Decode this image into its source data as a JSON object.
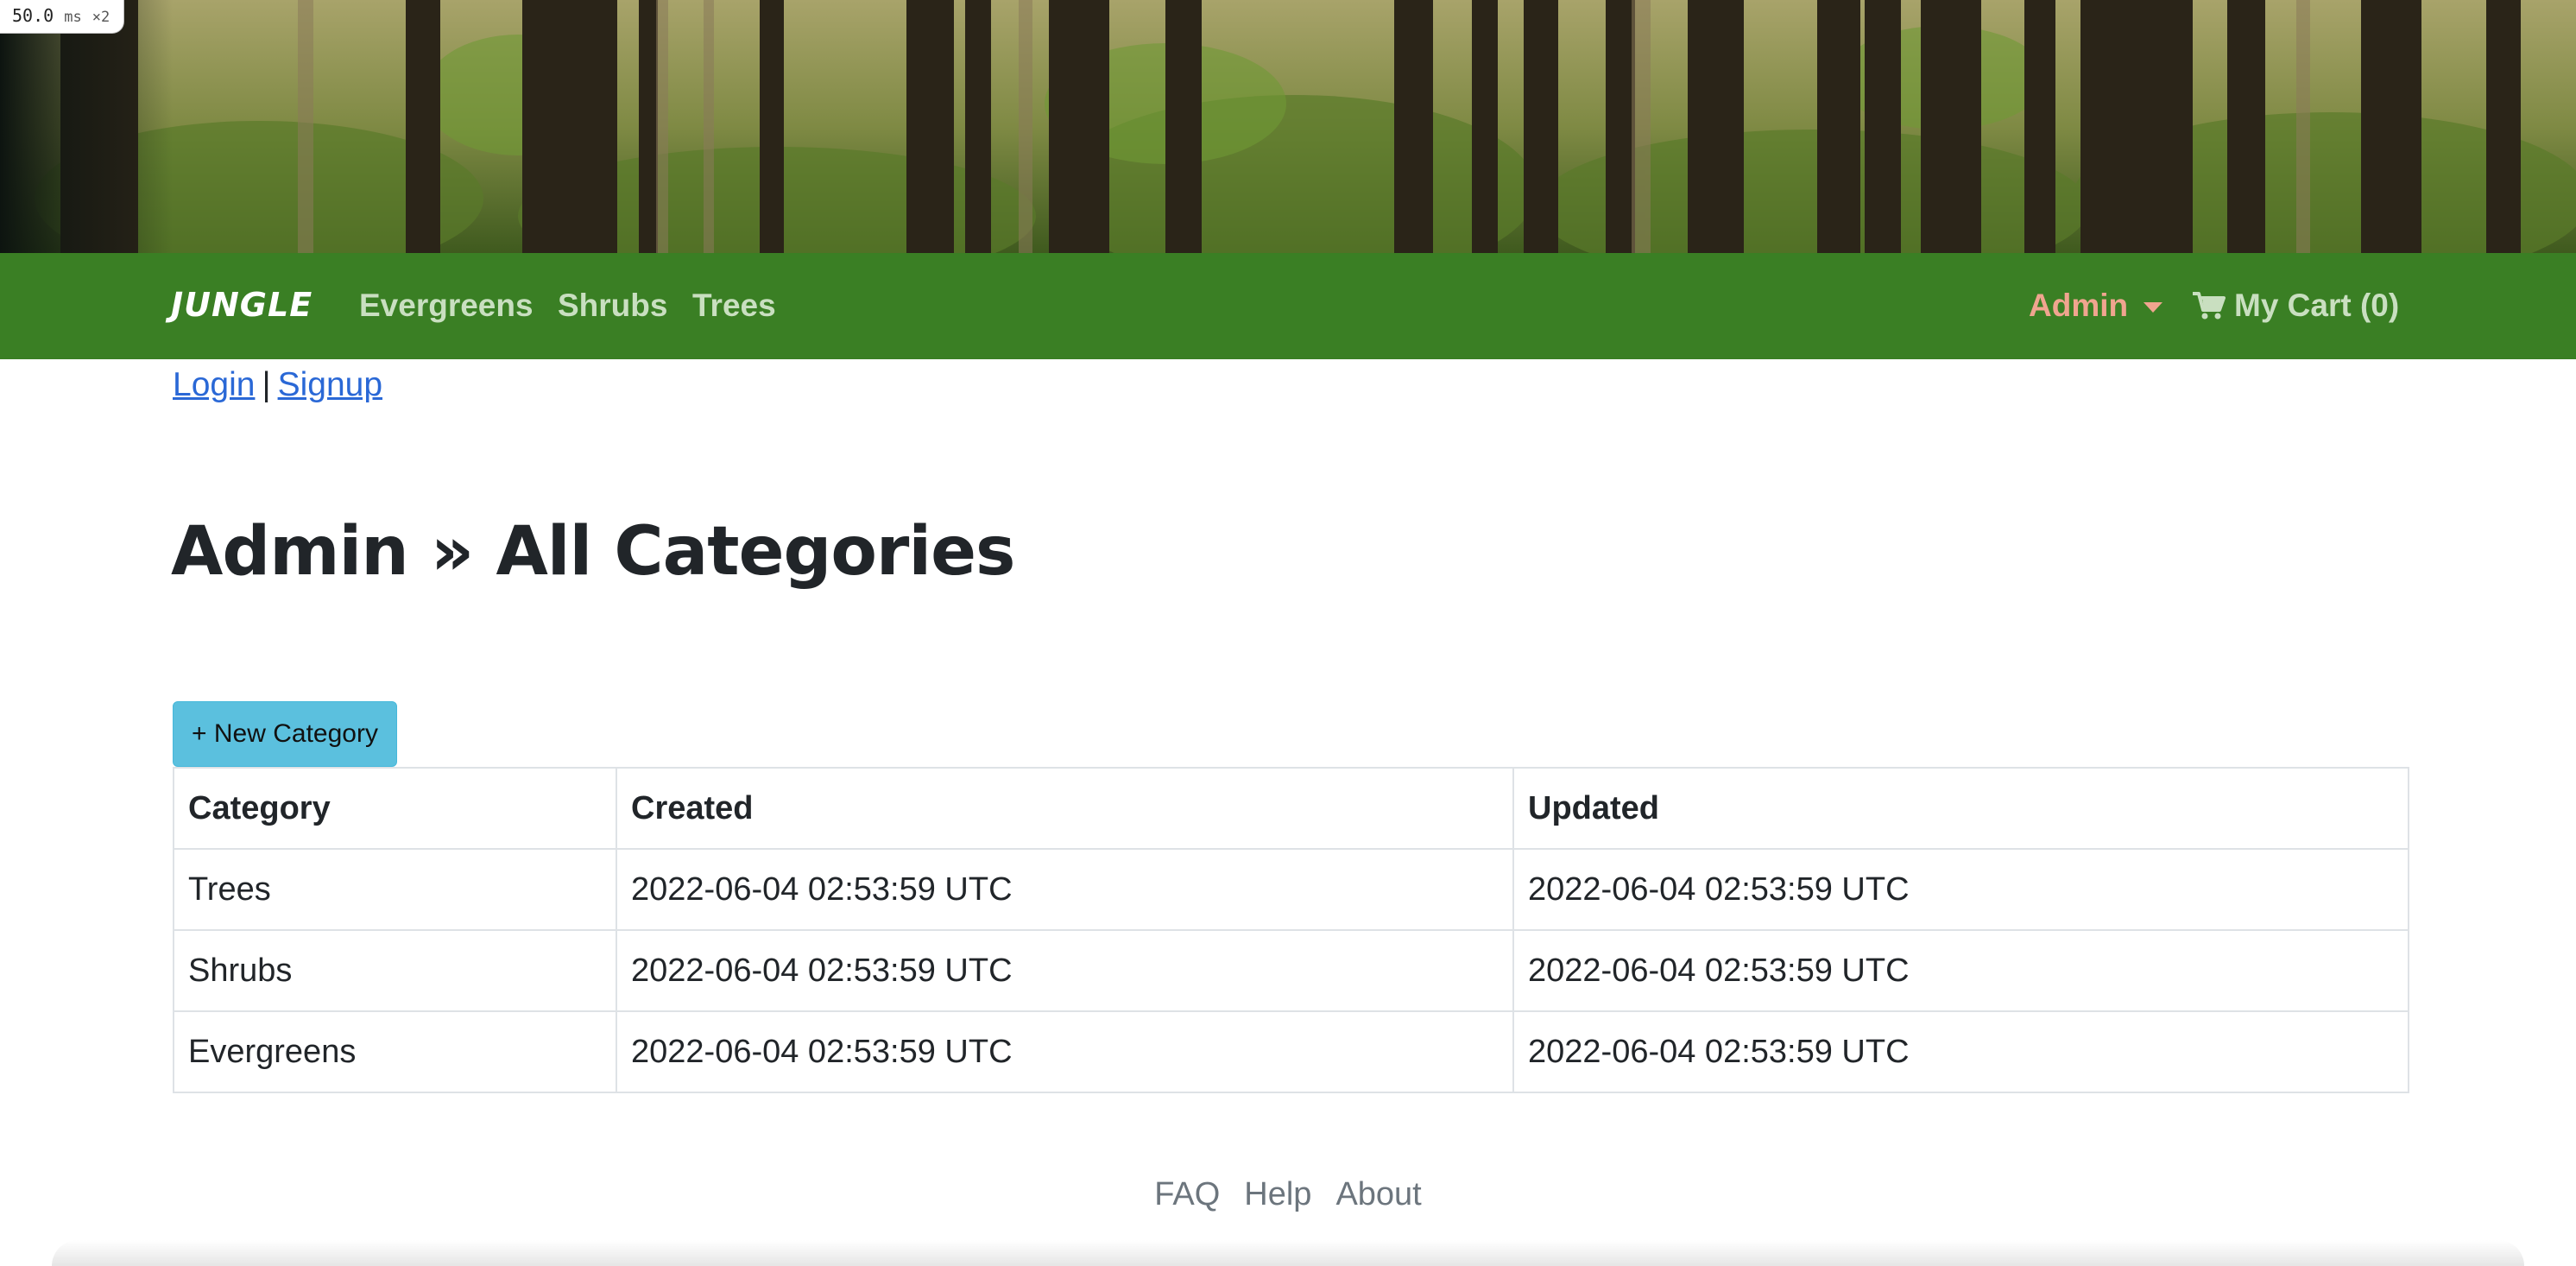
{
  "perf_badge": {
    "value": "50.0",
    "unit": "ms",
    "multiplier": "×2"
  },
  "navbar": {
    "brand": "JUNGLE",
    "links": [
      "Evergreens",
      "Shrubs",
      "Trees"
    ],
    "admin_label": "Admin",
    "cart_label": "My Cart (0)",
    "background_color": "#3a7f24",
    "admin_color": "#f0a58f"
  },
  "auth": {
    "login": "Login",
    "separator": "|",
    "signup": "Signup"
  },
  "page_title": "Admin » All Categories",
  "new_button": {
    "label": "+ New Category",
    "color": "#5bc0de"
  },
  "table": {
    "headers": [
      "Category",
      "Created",
      "Updated"
    ],
    "rows": [
      [
        "Trees",
        "2022-06-04 02:53:59 UTC",
        "2022-06-04 02:53:59 UTC"
      ],
      [
        "Shrubs",
        "2022-06-04 02:53:59 UTC",
        "2022-06-04 02:53:59 UTC"
      ],
      [
        "Evergreens",
        "2022-06-04 02:53:59 UTC",
        "2022-06-04 02:53:59 UTC"
      ]
    ]
  },
  "footer": {
    "links": [
      "FAQ",
      "Help",
      "About"
    ]
  },
  "icons": {
    "cart": "shopping-cart-icon",
    "admin_caret": "chevron-down-icon"
  }
}
